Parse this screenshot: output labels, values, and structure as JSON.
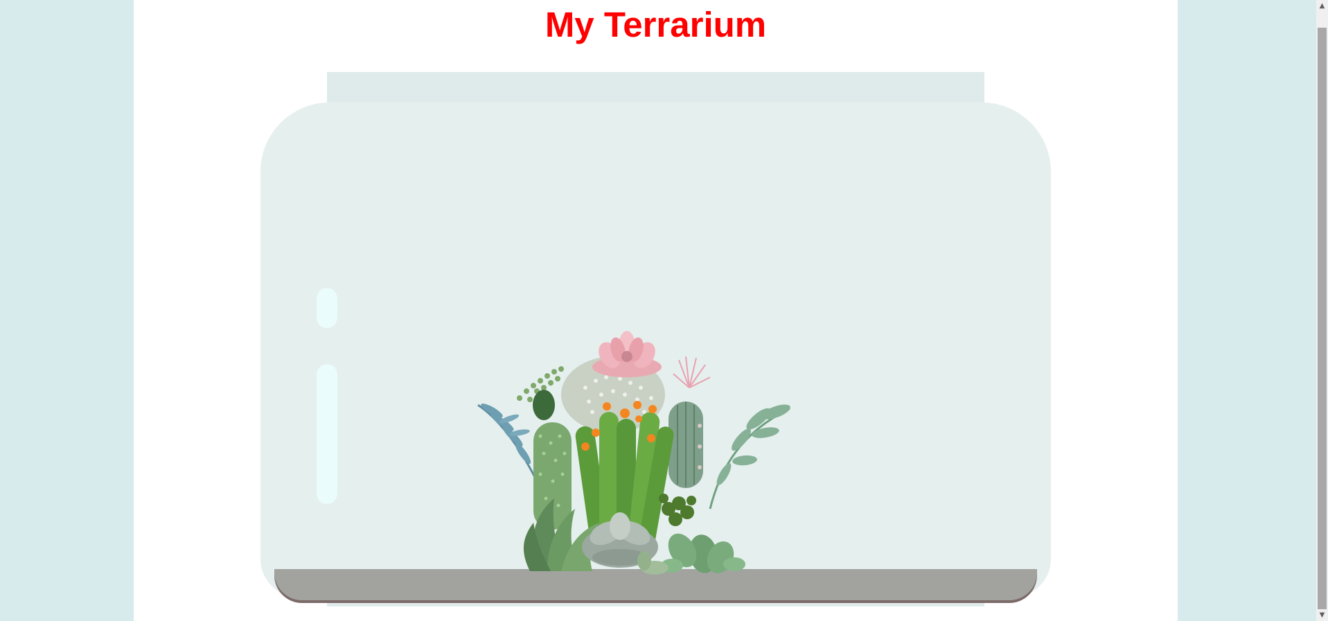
{
  "page": {
    "title": "My Terrarium"
  },
  "colors": {
    "background": "#d7ebec",
    "title": "#ff0000",
    "jar": "#e5efee",
    "jar_lid": "#dfeaea",
    "dirt": "#a2a39f",
    "glare": "#eafcfb"
  },
  "icons": {
    "scroll_up": "scroll-up-arrow-icon",
    "scroll_down": "scroll-down-arrow-icon"
  },
  "plants": [
    "blue-leaf-stem-plant",
    "green-leaf-stem-plant",
    "pink-succulent-plant",
    "white-dotted-cactus-plant",
    "orange-flower-cactus-plant",
    "tall-green-cactus-plant",
    "spiky-pink-flower-cactus-plant",
    "dark-spotted-cactus-plant",
    "aloe-succulent-plant",
    "grey-rosette-succulent-plant",
    "green-rosette-succulent-plant",
    "small-dark-green-plant",
    "tiny-leaf-vine-plant",
    "light-green-succulent-plant"
  ]
}
